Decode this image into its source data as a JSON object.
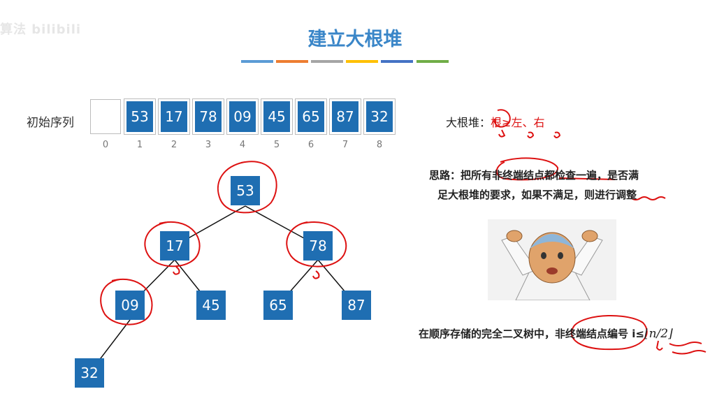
{
  "watermark": "算法 bilibili",
  "title": "建立大根堆",
  "accent_colors": [
    "#5b9bd5",
    "#ed7d31",
    "#a5a5a5",
    "#ffc000",
    "#4472c4",
    "#70ad47"
  ],
  "sequence": {
    "label": "初始序列",
    "cells": [
      "",
      "53",
      "17",
      "78",
      "09",
      "45",
      "65",
      "87",
      "32"
    ],
    "indices": [
      "0",
      "1",
      "2",
      "3",
      "4",
      "5",
      "6",
      "7",
      "8"
    ]
  },
  "tree": {
    "nodes": [
      "53",
      "17",
      "78",
      "09",
      "45",
      "65",
      "87",
      "32"
    ]
  },
  "notes": {
    "heap_prefix": "大根堆：",
    "heap_root": "根",
    "heap_rest": "≥左、右",
    "idea_line1_a": "思路：把所有",
    "idea_line1_b": "非终端结点",
    "idea_line1_c": "都检查一遍，是否满",
    "idea_line2_a": "足大根堆的要求，如果不满足，则进行",
    "idea_line2_b": "调整",
    "rule_a": "在顺序存储的完全二叉树中，",
    "rule_b": "非终端结点编号",
    "rule_c": " i≤",
    "rule_formula": "⌊n/2⌋"
  },
  "picture": {
    "icon": "thinking-cartoon-icon"
  }
}
